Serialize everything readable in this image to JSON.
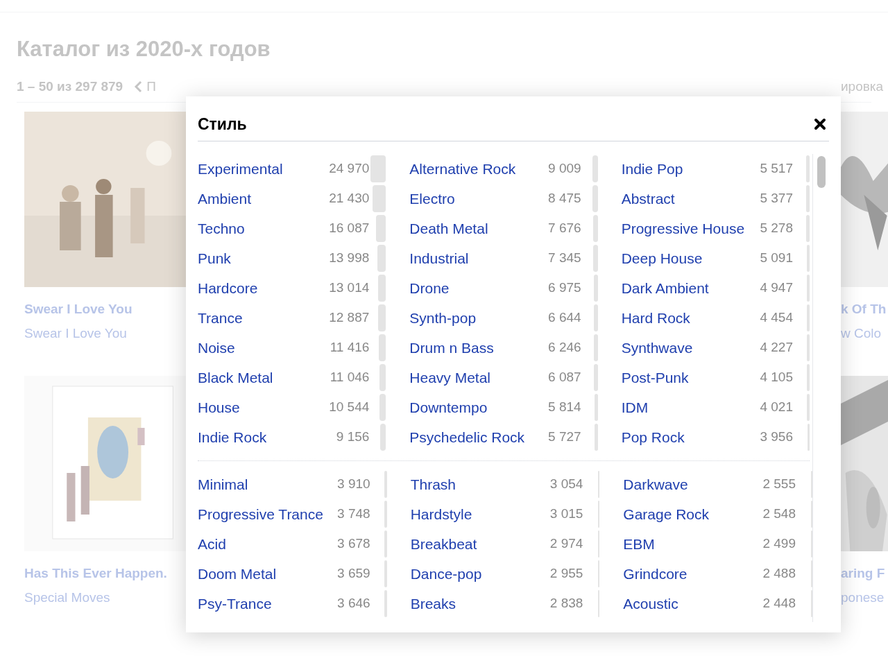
{
  "page": {
    "title": "Каталог из 2020-х годов",
    "range": "1 – 50 из 297 879",
    "prev_link": "П",
    "sort_link": "ировка"
  },
  "left_cards": [
    {
      "title": "Swear I Love You",
      "artist": "Swear I Love You",
      "kind": "picture"
    },
    {
      "title": "Has This Ever Happen.",
      "artist": "Special Moves",
      "kind": "picture"
    }
  ],
  "right_cards": [
    {
      "title": "k Of Th",
      "artist": "w Colo",
      "kind": "picture"
    },
    {
      "title": "aring F",
      "artist": "ponese",
      "kind": "picture"
    }
  ],
  "modal": {
    "title": "Стиль",
    "sections": [
      {
        "columns": [
          [
            {
              "name": "Experimental",
              "count": "24 970"
            },
            {
              "name": "Ambient",
              "count": "21 430"
            },
            {
              "name": "Techno",
              "count": "16 087"
            },
            {
              "name": "Punk",
              "count": "13 998"
            },
            {
              "name": "Hardcore",
              "count": "13 014"
            },
            {
              "name": "Trance",
              "count": "12 887"
            },
            {
              "name": "Noise",
              "count": "11 416"
            },
            {
              "name": "Black Metal",
              "count": "11 046"
            },
            {
              "name": "House",
              "count": "10 544"
            },
            {
              "name": "Indie Rock",
              "count": "9 156"
            }
          ],
          [
            {
              "name": "Alternative Rock",
              "count": "9 009"
            },
            {
              "name": "Electro",
              "count": "8 475"
            },
            {
              "name": "Death Metal",
              "count": "7 676"
            },
            {
              "name": "Industrial",
              "count": "7 345"
            },
            {
              "name": "Drone",
              "count": "6 975"
            },
            {
              "name": "Synth-pop",
              "count": "6 644"
            },
            {
              "name": "Drum n Bass",
              "count": "6 246"
            },
            {
              "name": "Heavy Metal",
              "count": "6 087"
            },
            {
              "name": "Downtempo",
              "count": "5 814"
            },
            {
              "name": "Psychedelic Rock",
              "count": "5 727"
            }
          ],
          [
            {
              "name": "Indie Pop",
              "count": "5 517"
            },
            {
              "name": "Abstract",
              "count": "5 377"
            },
            {
              "name": "Progressive House",
              "count": "5 278"
            },
            {
              "name": "Deep House",
              "count": "5 091"
            },
            {
              "name": "Dark Ambient",
              "count": "4 947"
            },
            {
              "name": "Hard Rock",
              "count": "4 454"
            },
            {
              "name": "Synthwave",
              "count": "4 227"
            },
            {
              "name": "Post-Punk",
              "count": "4 105"
            },
            {
              "name": "IDM",
              "count": "4 021"
            },
            {
              "name": "Pop Rock",
              "count": "3 956"
            }
          ]
        ]
      },
      {
        "columns": [
          [
            {
              "name": "Minimal",
              "count": "3 910"
            },
            {
              "name": "Progressive Trance",
              "count": "3 748"
            },
            {
              "name": "Acid",
              "count": "3 678"
            },
            {
              "name": "Doom Metal",
              "count": "3 659"
            },
            {
              "name": "Psy-Trance",
              "count": "3 646"
            }
          ],
          [
            {
              "name": "Thrash",
              "count": "3 054"
            },
            {
              "name": "Hardstyle",
              "count": "3 015"
            },
            {
              "name": "Breakbeat",
              "count": "2 974"
            },
            {
              "name": "Dance-pop",
              "count": "2 955"
            },
            {
              "name": "Breaks",
              "count": "2 838"
            }
          ],
          [
            {
              "name": "Darkwave",
              "count": "2 555"
            },
            {
              "name": "Garage Rock",
              "count": "2 548"
            },
            {
              "name": "EBM",
              "count": "2 499"
            },
            {
              "name": "Grindcore",
              "count": "2 488"
            },
            {
              "name": "Acoustic",
              "count": "2 448"
            }
          ]
        ]
      }
    ]
  }
}
